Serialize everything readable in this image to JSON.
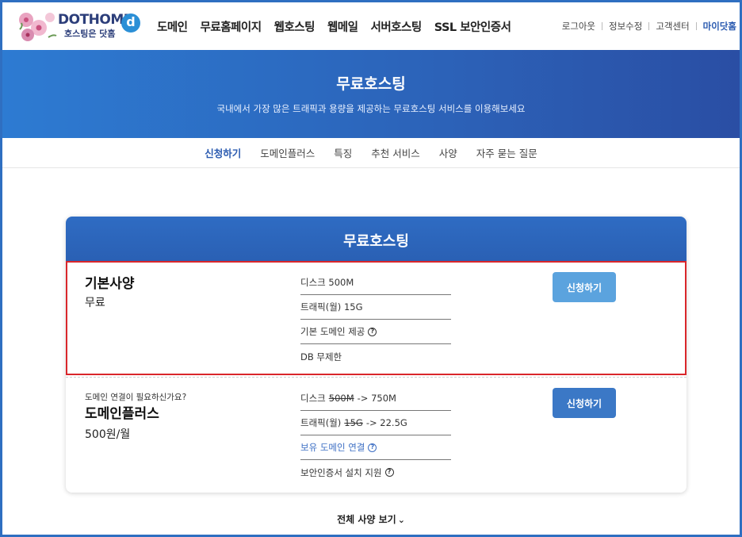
{
  "header": {
    "logo_text": "DOTHOME",
    "logo_sub": "호스팅은 닷홈",
    "logo_mark": "d",
    "nav": [
      "도메인",
      "무료홈페이지",
      "웹호스팅",
      "웹메일",
      "서버호스팅",
      "SSL 보안인증서"
    ],
    "util": [
      "로그아웃",
      "정보수정",
      "고객센터",
      "마이닷홈"
    ]
  },
  "banner": {
    "title": "무료호스팅",
    "subtitle": "국내에서 가장 많은 트래픽과 용량을 제공하는 무료호스팅 서비스를 이용해보세요"
  },
  "subnav": {
    "items": [
      "신청하기",
      "도메인플러스",
      "특징",
      "추천 서비스",
      "사양",
      "자주 묻는 질문"
    ],
    "active": "신청하기"
  },
  "card": {
    "title": "무료호스팅",
    "basic": {
      "name": "기본사양",
      "price": "무료",
      "specs": [
        "디스크 500M",
        "트래픽(월) 15G",
        "기본 도메인 제공",
        "DB 무제한"
      ],
      "button": "신청하기"
    },
    "plus": {
      "pretitle": "도메인 연결이 필요하신가요?",
      "name": "도메인플러스",
      "price": "500원/월",
      "spec1_label": "디스크",
      "spec1_old": "500M",
      "spec1_new": "-> 750M",
      "spec2_label": "트래픽(월)",
      "spec2_old": "15G",
      "spec2_new": "-> 22.5G",
      "spec3": "보유 도메인 연결",
      "spec4": "보안인증서 설치 지원",
      "button": "신청하기"
    }
  },
  "more": {
    "label": "전체 사양 보기"
  },
  "colors": {
    "brand_blue": "#2b5bb0",
    "highlight_red": "#d9262b",
    "button_light": "#5ba3de",
    "button_dark": "#3b78c6"
  }
}
